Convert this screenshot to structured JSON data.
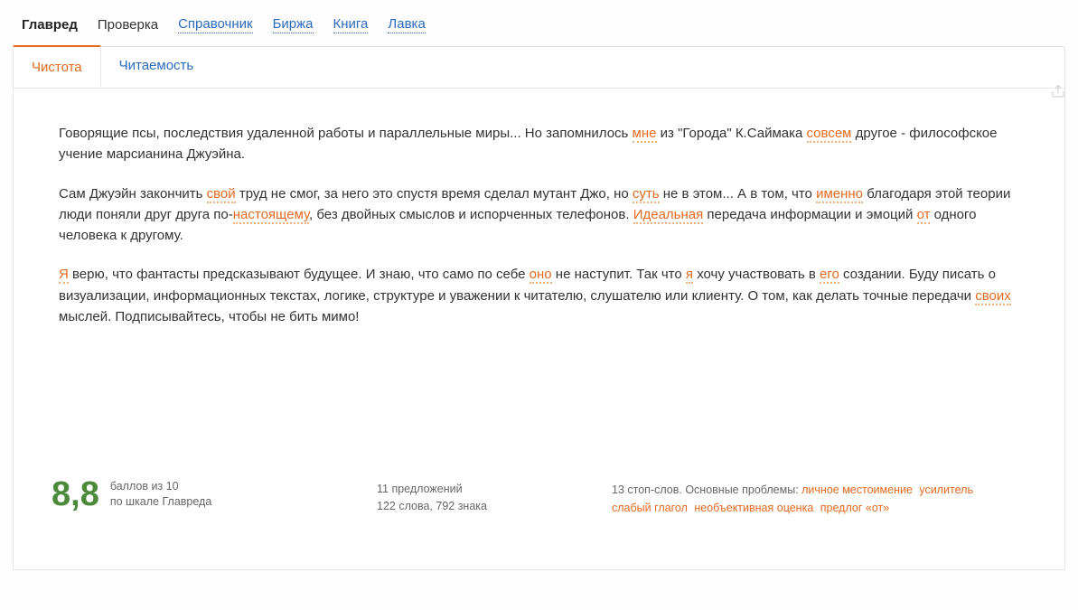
{
  "nav": {
    "brand": "Главред",
    "items": [
      {
        "label": "Проверка",
        "link": false
      },
      {
        "label": "Справочник",
        "link": true
      },
      {
        "label": "Биржа",
        "link": true
      },
      {
        "label": "Книга",
        "link": true
      },
      {
        "label": "Лавка",
        "link": true
      }
    ]
  },
  "tabs": {
    "active": "Чистота",
    "items": [
      "Чистота",
      "Читаемость"
    ]
  },
  "text": {
    "p1_a": "Говорящие псы, последствия удаленной работы и параллельные миры... Но запомнилось ",
    "p1_h1": "мне",
    "p1_b": " из \"Города\" К.Саймака ",
    "p1_h2": "совсем",
    "p1_c": " другое - философское учение марсианина Джуэйна.",
    "p2_a": "Сам Джуэйн закончить ",
    "p2_h1": "свой",
    "p2_b": " труд не смог, за него это спустя время сделал мутант Джо, но ",
    "p2_h2": "суть",
    "p2_c": " не в этом... А в том, что ",
    "p2_h3": "именно",
    "p2_d": " благодаря этой теории люди поняли друг друга по-",
    "p2_h4": "настоящему",
    "p2_e": ", без двойных смыслов и испорченных телефонов. ",
    "p2_h5": "Идеальная",
    "p2_f": " передача информации и эмоций ",
    "p2_h6": "от",
    "p2_g": " одного человека к другому.",
    "p3_h1": "Я",
    "p3_a": " верю, что фантасты предсказывают будущее. И знаю, что само по себе ",
    "p3_h2": "оно",
    "p3_b": " не наступит. Так что ",
    "p3_h3": "я",
    "p3_c": " хочу участвовать в ",
    "p3_h4": "его",
    "p3_d": " создании. Буду писать о визуализации, информационных текстах, логике, структуре и уважении к читателю, слушателю или клиенту. О том, как делать точные передачи ",
    "p3_h5": "своих",
    "p3_e": " мыслей. Подписывайтесь, чтобы не бить мимо!"
  },
  "footer": {
    "score": "8,8",
    "score_line1": "баллов из 10",
    "score_line2": "по шкале Главреда",
    "stats_line1": "11 предложений",
    "stats_line2": "122 слова, 792 знака",
    "problems_prefix": "13 стоп-слов. Основные проблемы: ",
    "problems": [
      "личное местоимение",
      "усилитель",
      "слабый глагол",
      "необъективная оценка",
      "предлог «от»"
    ]
  }
}
